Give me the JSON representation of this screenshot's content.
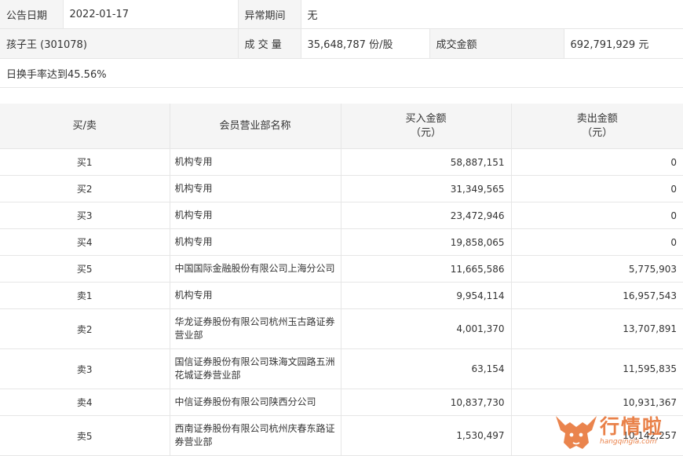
{
  "info": {
    "date_label": "公告日期",
    "date_value": "2022-01-17",
    "period_label": "异常期间",
    "period_value": "无",
    "stock": "孩子王 (301078)",
    "volume_label": "成 交 量",
    "volume_value": "35,648,787 份/股",
    "amount_label": "成交金额",
    "amount_value": "692,791,929 元",
    "reason": "日换手率达到45.56%"
  },
  "table": {
    "headers": {
      "type": "买/卖",
      "name": "会员营业部名称",
      "buy_line1": "买入金额",
      "buy_line2": "（元）",
      "sell_line1": "卖出金额",
      "sell_line2": "（元）"
    },
    "rows": [
      {
        "type": "买1",
        "name": "机构专用",
        "buy": "58,887,151",
        "sell": "0"
      },
      {
        "type": "买2",
        "name": "机构专用",
        "buy": "31,349,565",
        "sell": "0"
      },
      {
        "type": "买3",
        "name": "机构专用",
        "buy": "23,472,946",
        "sell": "0"
      },
      {
        "type": "买4",
        "name": "机构专用",
        "buy": "19,858,065",
        "sell": "0"
      },
      {
        "type": "买5",
        "name": "中国国际金融股份有限公司上海分公司",
        "buy": "11,665,586",
        "sell": "5,775,903"
      },
      {
        "type": "卖1",
        "name": "机构专用",
        "buy": "9,954,114",
        "sell": "16,957,543"
      },
      {
        "type": "卖2",
        "name": "华龙证券股份有限公司杭州玉古路证券营业部",
        "buy": "4,001,370",
        "sell": "13,707,891"
      },
      {
        "type": "卖3",
        "name": "国信证券股份有限公司珠海文园路五洲花城证券营业部",
        "buy": "63,154",
        "sell": "11,595,835"
      },
      {
        "type": "卖4",
        "name": "中信证券股份有限公司陕西分公司",
        "buy": "10,837,730",
        "sell": "10,931,367"
      },
      {
        "type": "卖5",
        "name": "西南证券股份有限公司杭州庆春东路证券营业部",
        "buy": "1,530,497",
        "sell": "10,142,257"
      }
    ]
  },
  "watermark": {
    "brand": "行情啦",
    "url": "hangqingla.com",
    "icon": "bull-logo-icon",
    "color": "#e8773a"
  }
}
